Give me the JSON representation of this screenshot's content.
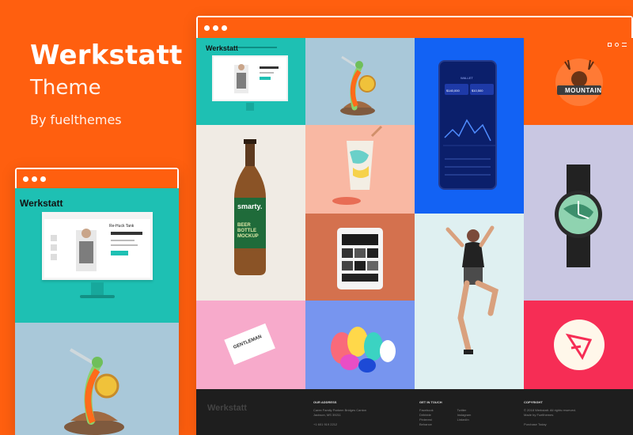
{
  "promo": {
    "title": "Werkstatt",
    "subtitle": "Theme",
    "byline": "By fuelthemes"
  },
  "site": {
    "logo": "Werkstatt",
    "product_title": "Re-Huck Tank",
    "mockup_bottle": "BEER BOTTLE MOCKUP",
    "bottle_brand": "smarty.",
    "wallet_title": "WALLET",
    "wallet_amount_left": "$140,000",
    "wallet_amount_right": "$10,500",
    "badge_text": "MOUNTAIN",
    "card_text": "GENTLEMAN"
  },
  "footer": {
    "logo": "Werkstatt",
    "col1_title": "OUR ADDRESS",
    "col1_lines": [
      "Carex Family Parkem Bridges Canton",
      "Jackson, MS 39211",
      "",
      "+1 601 919 2212"
    ],
    "col2_title": "GET IN TOUCH",
    "col2_a": [
      "Facebook",
      "Dribbble",
      "Pinterest",
      "Behance"
    ],
    "col2_b": [
      "Twitter",
      "Instagram",
      "LinkedIn"
    ],
    "col3_title": "COPYRIGHT",
    "col3_lines": [
      "© 2018 Werkstatt. All rights reserved.",
      "Made by Fuelthemes",
      "",
      "Purchase Today"
    ]
  },
  "colors": {
    "brand": "#ff5f0f",
    "teal": "#1ec0b3",
    "sky": "#a9c8d9",
    "blue": "#1262f4",
    "cream": "#f0ebe4",
    "peach": "#f9b8a3",
    "terracotta": "#d4714e",
    "lavender": "#c9c7e2",
    "pink": "#f7aacb",
    "periwinkle": "#7795ef",
    "ice": "#dff0f1",
    "coral": "#f62d55"
  }
}
